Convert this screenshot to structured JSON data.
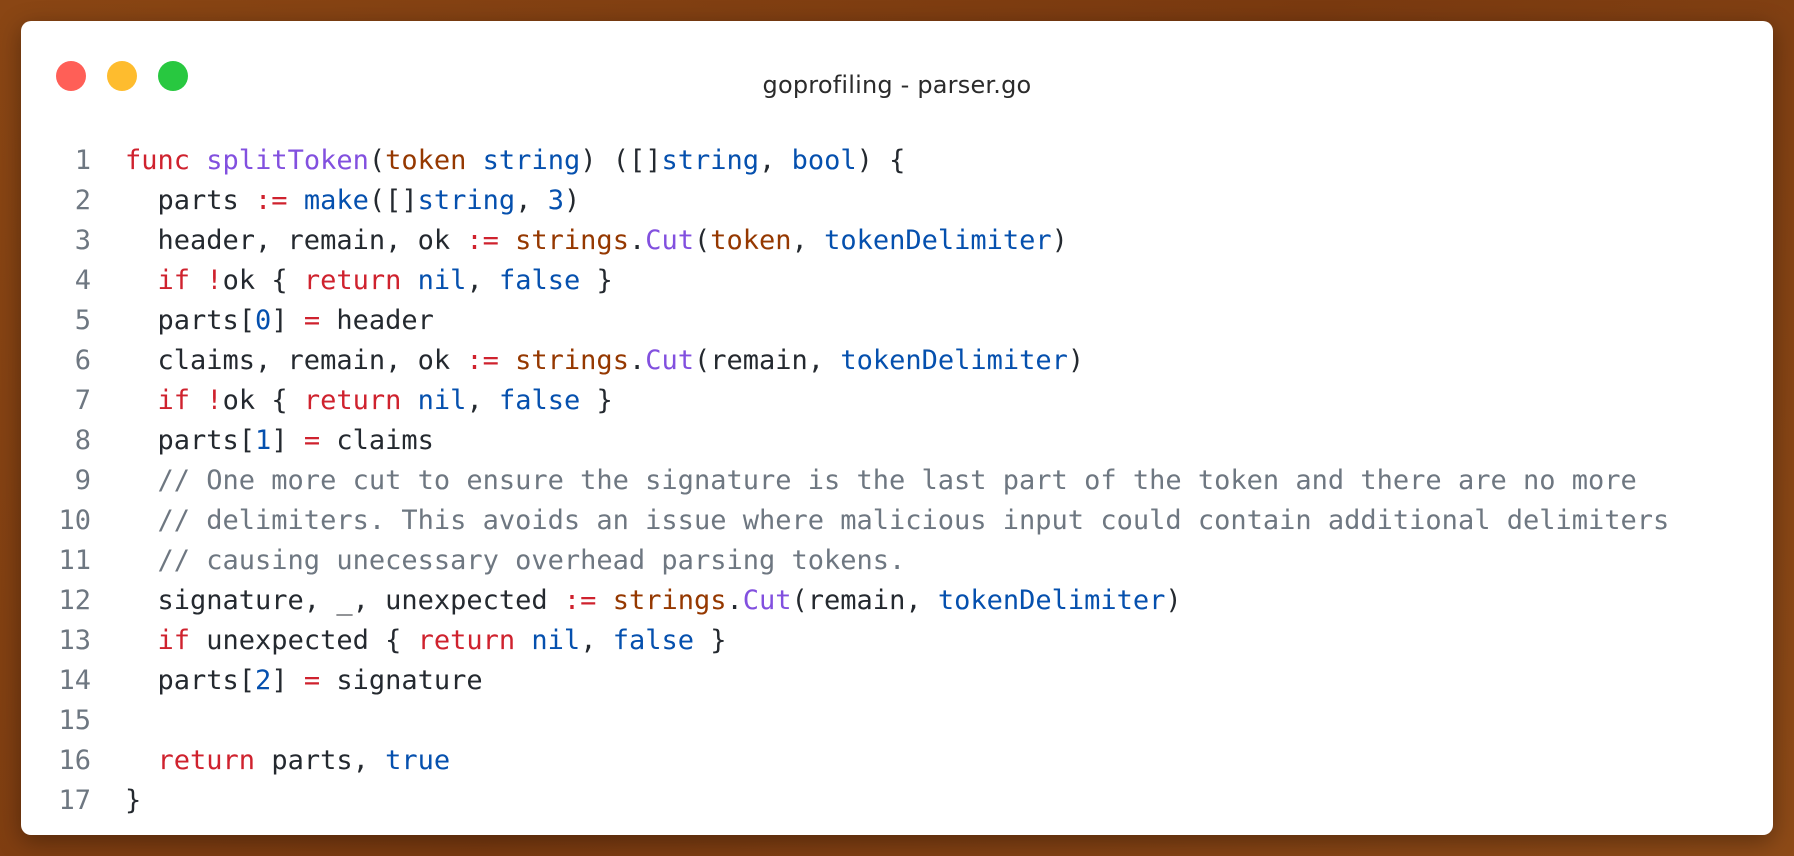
{
  "window": {
    "title": "goprofiling - parser.go"
  },
  "colors": {
    "background": "#8a4614",
    "keyword": "#cf222e",
    "function": "#8250df",
    "type": "#0550ae",
    "parameter": "#953800",
    "comment": "#6e7781",
    "text": "#24292f"
  },
  "code": {
    "lines": [
      [
        {
          "t": "func",
          "c": "kw"
        },
        {
          "t": " ",
          "c": "pl"
        },
        {
          "t": "splitToken",
          "c": "fn"
        },
        {
          "t": "(",
          "c": "pl"
        },
        {
          "t": "token",
          "c": "par"
        },
        {
          "t": " ",
          "c": "pl"
        },
        {
          "t": "string",
          "c": "ty"
        },
        {
          "t": ") ([]",
          "c": "pl"
        },
        {
          "t": "string",
          "c": "ty"
        },
        {
          "t": ", ",
          "c": "pl"
        },
        {
          "t": "bool",
          "c": "ty"
        },
        {
          "t": ") {",
          "c": "pl"
        }
      ],
      [
        {
          "t": "  parts ",
          "c": "pl"
        },
        {
          "t": ":=",
          "c": "op"
        },
        {
          "t": " ",
          "c": "pl"
        },
        {
          "t": "make",
          "c": "ty"
        },
        {
          "t": "([]",
          "c": "pl"
        },
        {
          "t": "string",
          "c": "ty"
        },
        {
          "t": ", ",
          "c": "pl"
        },
        {
          "t": "3",
          "c": "num"
        },
        {
          "t": ")",
          "c": "pl"
        }
      ],
      [
        {
          "t": "  header, remain, ok ",
          "c": "pl"
        },
        {
          "t": ":=",
          "c": "op"
        },
        {
          "t": " ",
          "c": "pl"
        },
        {
          "t": "strings",
          "c": "pkg"
        },
        {
          "t": ".",
          "c": "pl"
        },
        {
          "t": "Cut",
          "c": "fn"
        },
        {
          "t": "(",
          "c": "pl"
        },
        {
          "t": "token",
          "c": "par"
        },
        {
          "t": ", ",
          "c": "pl"
        },
        {
          "t": "tokenDelimiter",
          "c": "ty"
        },
        {
          "t": ")",
          "c": "pl"
        }
      ],
      [
        {
          "t": "  ",
          "c": "pl"
        },
        {
          "t": "if",
          "c": "kw"
        },
        {
          "t": " ",
          "c": "pl"
        },
        {
          "t": "!",
          "c": "op"
        },
        {
          "t": "ok { ",
          "c": "pl"
        },
        {
          "t": "return",
          "c": "kw"
        },
        {
          "t": " ",
          "c": "pl"
        },
        {
          "t": "nil",
          "c": "ty"
        },
        {
          "t": ", ",
          "c": "pl"
        },
        {
          "t": "false",
          "c": "ty"
        },
        {
          "t": " }",
          "c": "pl"
        }
      ],
      [
        {
          "t": "  parts[",
          "c": "pl"
        },
        {
          "t": "0",
          "c": "num"
        },
        {
          "t": "] ",
          "c": "pl"
        },
        {
          "t": "=",
          "c": "op"
        },
        {
          "t": " header",
          "c": "pl"
        }
      ],
      [
        {
          "t": "  claims, remain, ok ",
          "c": "pl"
        },
        {
          "t": ":=",
          "c": "op"
        },
        {
          "t": " ",
          "c": "pl"
        },
        {
          "t": "strings",
          "c": "pkg"
        },
        {
          "t": ".",
          "c": "pl"
        },
        {
          "t": "Cut",
          "c": "fn"
        },
        {
          "t": "(remain, ",
          "c": "pl"
        },
        {
          "t": "tokenDelimiter",
          "c": "ty"
        },
        {
          "t": ")",
          "c": "pl"
        }
      ],
      [
        {
          "t": "  ",
          "c": "pl"
        },
        {
          "t": "if",
          "c": "kw"
        },
        {
          "t": " ",
          "c": "pl"
        },
        {
          "t": "!",
          "c": "op"
        },
        {
          "t": "ok { ",
          "c": "pl"
        },
        {
          "t": "return",
          "c": "kw"
        },
        {
          "t": " ",
          "c": "pl"
        },
        {
          "t": "nil",
          "c": "ty"
        },
        {
          "t": ", ",
          "c": "pl"
        },
        {
          "t": "false",
          "c": "ty"
        },
        {
          "t": " }",
          "c": "pl"
        }
      ],
      [
        {
          "t": "  parts[",
          "c": "pl"
        },
        {
          "t": "1",
          "c": "num"
        },
        {
          "t": "] ",
          "c": "pl"
        },
        {
          "t": "=",
          "c": "op"
        },
        {
          "t": " claims",
          "c": "pl"
        }
      ],
      [
        {
          "t": "  // One more cut to ensure the signature is the last part of the token and there are no more",
          "c": "cm"
        }
      ],
      [
        {
          "t": "  // delimiters. This avoids an issue where malicious input could contain additional delimiters",
          "c": "cm"
        }
      ],
      [
        {
          "t": "  // causing unecessary overhead parsing tokens.",
          "c": "cm"
        }
      ],
      [
        {
          "t": "  signature, _, unexpected ",
          "c": "pl"
        },
        {
          "t": ":=",
          "c": "op"
        },
        {
          "t": " ",
          "c": "pl"
        },
        {
          "t": "strings",
          "c": "pkg"
        },
        {
          "t": ".",
          "c": "pl"
        },
        {
          "t": "Cut",
          "c": "fn"
        },
        {
          "t": "(remain, ",
          "c": "pl"
        },
        {
          "t": "tokenDelimiter",
          "c": "ty"
        },
        {
          "t": ")",
          "c": "pl"
        }
      ],
      [
        {
          "t": "  ",
          "c": "pl"
        },
        {
          "t": "if",
          "c": "kw"
        },
        {
          "t": " unexpected { ",
          "c": "pl"
        },
        {
          "t": "return",
          "c": "kw"
        },
        {
          "t": " ",
          "c": "pl"
        },
        {
          "t": "nil",
          "c": "ty"
        },
        {
          "t": ", ",
          "c": "pl"
        },
        {
          "t": "false",
          "c": "ty"
        },
        {
          "t": " }",
          "c": "pl"
        }
      ],
      [
        {
          "t": "  parts[",
          "c": "pl"
        },
        {
          "t": "2",
          "c": "num"
        },
        {
          "t": "] ",
          "c": "pl"
        },
        {
          "t": "=",
          "c": "op"
        },
        {
          "t": " signature",
          "c": "pl"
        }
      ],
      [],
      [
        {
          "t": "  ",
          "c": "pl"
        },
        {
          "t": "return",
          "c": "kw"
        },
        {
          "t": " parts, ",
          "c": "pl"
        },
        {
          "t": "true",
          "c": "ty"
        }
      ],
      [
        {
          "t": "}",
          "c": "pl"
        }
      ]
    ]
  }
}
